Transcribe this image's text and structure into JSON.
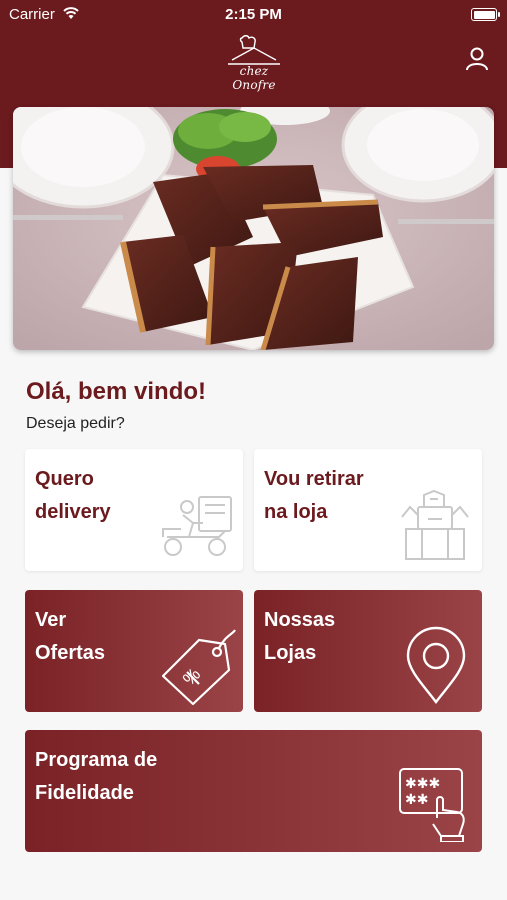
{
  "status_bar": {
    "carrier": "Carrier",
    "time": "2:15 PM"
  },
  "header": {
    "logo_text": "chez Onofre"
  },
  "greeting": {
    "title": "Olá, bem vindo!",
    "subtitle": "Deseja pedir?"
  },
  "cards": {
    "delivery": {
      "line1": "Quero",
      "line2": "delivery",
      "icon": "delivery-scooter-icon"
    },
    "pickup": {
      "line1": "Vou retirar",
      "line2": "na loja",
      "icon": "store-pickup-icon"
    },
    "offers": {
      "line1": "Ver",
      "line2": "Ofertas",
      "icon": "price-tag-icon"
    },
    "stores": {
      "line1": "Nossas",
      "line2": "Lojas",
      "icon": "map-pin-icon"
    },
    "loyalty": {
      "line1": "Programa de",
      "line2": "Fidelidade",
      "icon": "loyalty-card-icon"
    }
  },
  "colors": {
    "brand": "#6b1a1e",
    "background": "#f7f7f7",
    "card": "#ffffff"
  }
}
